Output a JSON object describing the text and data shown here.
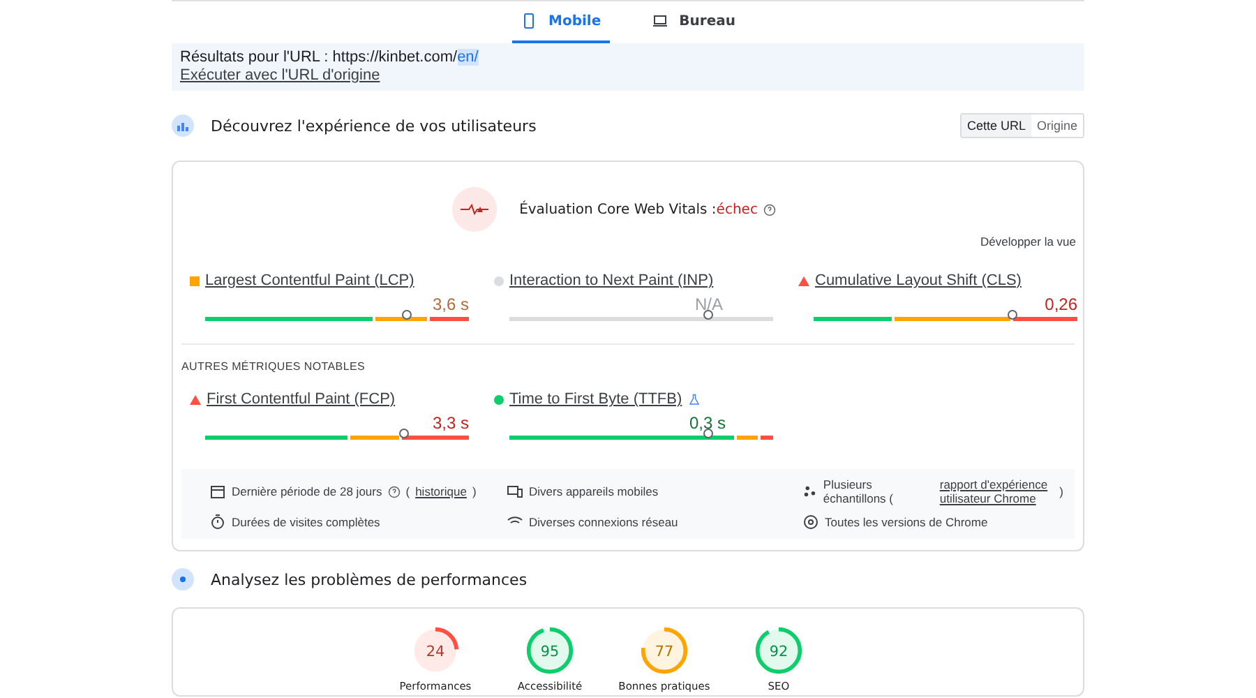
{
  "tabs": [
    {
      "label": "Mobile",
      "selected": true
    },
    {
      "label": "Bureau",
      "selected": false
    }
  ],
  "url_banner": {
    "prefix": "Résultats pour l'URL : https://kinbet.com/",
    "highlight": "en/",
    "link": "Exécuter avec l'URL d'origine"
  },
  "field_section": {
    "title": "Découvrez l'expérience de vos utilisateurs",
    "toggle": [
      {
        "label": "Cette URL",
        "selected": true
      },
      {
        "label": "Origine",
        "selected": false
      }
    ]
  },
  "assessment": {
    "label": "Évaluation Core Web Vitals :",
    "result": "échec",
    "expand": "Développer la vue"
  },
  "core_metrics": [
    {
      "name": "Largest Contentful Paint (LCP)",
      "kind": "square",
      "color": "#ffa400",
      "value": "3,6 s",
      "marker": {
        "level": 0.76
      }
    },
    {
      "name": "Interaction to Next Paint (INP)",
      "kind": "circle",
      "color": "#dadce0",
      "value": "N/A",
      "marker": {
        "level": 0.75
      }
    },
    {
      "name": "Cumulative Layout Shift (CLS)",
      "kind": "triangle",
      "color": "#ff4e42",
      "value": "0,26",
      "marker": {
        "level": 0.75
      }
    }
  ],
  "other_title": "AUTRES MÉTRIQUES NOTABLES",
  "other_metrics": [
    {
      "name": "First Contentful Paint (FCP)",
      "kind": "triangle",
      "color": "#ff4e42",
      "value": "3,3 s",
      "experimental": false,
      "marker": {
        "level": 0.75
      }
    },
    {
      "name": "Time to First Byte (TTFB)",
      "kind": "circle",
      "color": "#0cce6b",
      "value": "0,3 s",
      "experimental": true,
      "marker": {
        "level": 0.75
      }
    }
  ],
  "info": [
    {
      "text": "Dernière période de 28 jours",
      "help": true,
      "link_before": "(",
      "link": "historique",
      "link_after": ")"
    },
    {
      "text": "Divers appareils mobiles",
      "help": false
    },
    {
      "text": "Plusieurs échantillons (",
      "help": false,
      "link": "rapport d'expérience utilisateur Chrome",
      "link_after": ")"
    },
    {
      "text": "Durées de visites complètes",
      "help": false
    },
    {
      "text": "Diverses connexions réseau",
      "help": false
    },
    {
      "text": "Toutes les versions de Chrome",
      "help": false
    }
  ],
  "lab_section": {
    "title": "Analysez les problèmes de performances"
  },
  "scores": [
    {
      "score": "24",
      "label": "Performances",
      "color": "#ff4e42"
    },
    {
      "score": "95",
      "label": "Accessibilité",
      "color": "#0cce6b"
    },
    {
      "score": "77",
      "label": "Bonnes pratiques",
      "color": "#ffa400"
    },
    {
      "score": "92",
      "label": "SEO",
      "color": "#0cce6b"
    }
  ]
}
